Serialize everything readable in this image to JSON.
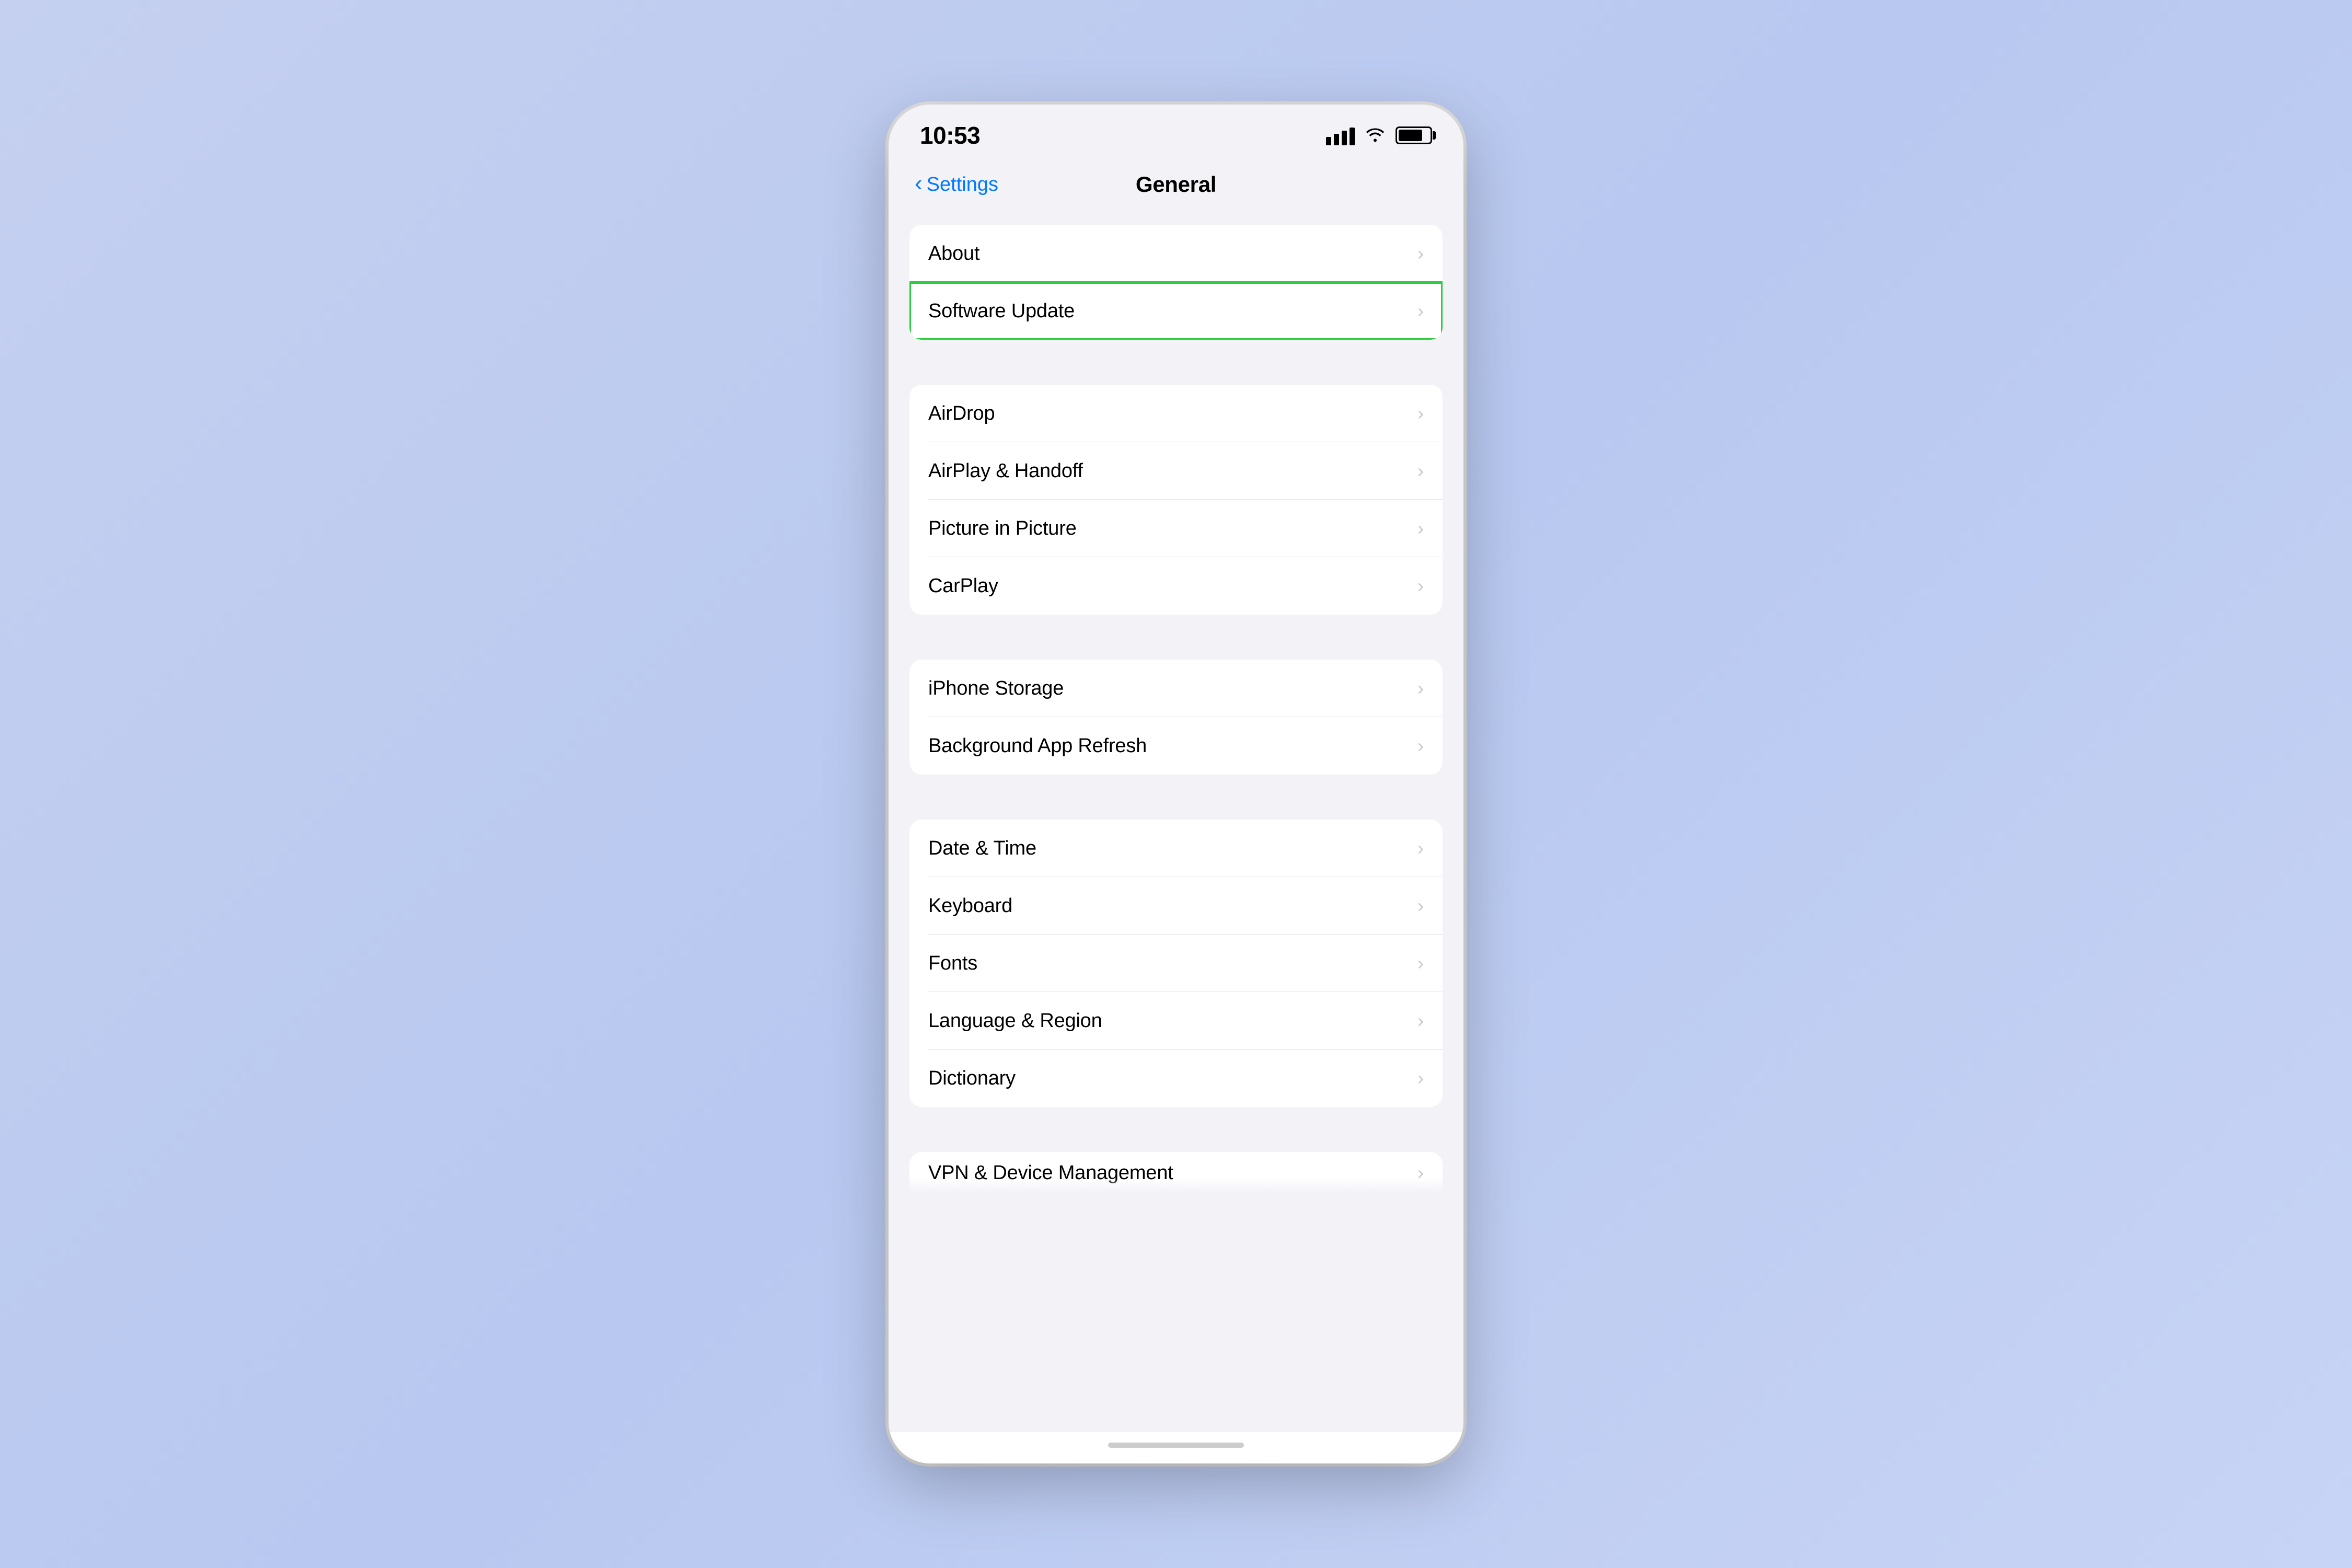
{
  "status_bar": {
    "time": "10:53",
    "signal_label": "signal",
    "wifi_label": "wifi",
    "battery_label": "battery"
  },
  "nav": {
    "back_label": "Settings",
    "title": "General"
  },
  "sections": [
    {
      "id": "section1",
      "items": [
        {
          "id": "about",
          "label": "About",
          "highlighted": false
        },
        {
          "id": "software-update",
          "label": "Software Update",
          "highlighted": true
        }
      ]
    },
    {
      "id": "section2",
      "items": [
        {
          "id": "airdrop",
          "label": "AirDrop",
          "highlighted": false
        },
        {
          "id": "airplay-handoff",
          "label": "AirPlay & Handoff",
          "highlighted": false
        },
        {
          "id": "picture-in-picture",
          "label": "Picture in Picture",
          "highlighted": false
        },
        {
          "id": "carplay",
          "label": "CarPlay",
          "highlighted": false
        }
      ]
    },
    {
      "id": "section3",
      "items": [
        {
          "id": "iphone-storage",
          "label": "iPhone Storage",
          "highlighted": false
        },
        {
          "id": "background-app-refresh",
          "label": "Background App Refresh",
          "highlighted": false
        }
      ]
    },
    {
      "id": "section4",
      "items": [
        {
          "id": "date-time",
          "label": "Date & Time",
          "highlighted": false
        },
        {
          "id": "keyboard",
          "label": "Keyboard",
          "highlighted": false
        },
        {
          "id": "fonts",
          "label": "Fonts",
          "highlighted": false
        },
        {
          "id": "language-region",
          "label": "Language & Region",
          "highlighted": false
        },
        {
          "id": "dictionary",
          "label": "Dictionary",
          "highlighted": false
        }
      ]
    }
  ],
  "partial_item": {
    "label": "VPN & Device Management"
  },
  "chevron": "›",
  "back_chevron": "‹"
}
